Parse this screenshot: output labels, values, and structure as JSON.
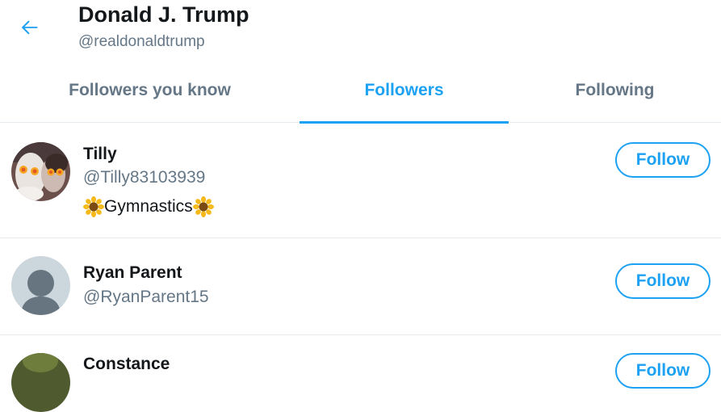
{
  "header": {
    "title": "Donald J. Trump",
    "handle": "@realdonaldtrump",
    "back_icon": "arrow-left-icon"
  },
  "tabs": [
    {
      "label": "Followers you know",
      "active": false
    },
    {
      "label": "Followers",
      "active": true
    },
    {
      "label": "Following",
      "active": false
    }
  ],
  "users": [
    {
      "name": "Tilly",
      "handle": "@Tilly83103939",
      "bio_text": "Gymnastics",
      "bio_icon": "sunflower-icon",
      "follow_label": "Follow",
      "avatar": "photo-avatar"
    },
    {
      "name": "Ryan Parent",
      "handle": "@RyanParent15",
      "follow_label": "Follow",
      "avatar": "default-avatar"
    },
    {
      "name": "Constance",
      "follow_label": "Follow",
      "avatar": "photo-avatar"
    }
  ],
  "colors": {
    "accent": "#1da1f2",
    "secondary_text": "#657786",
    "primary_text": "#14171a",
    "border": "#e6ecf0"
  }
}
